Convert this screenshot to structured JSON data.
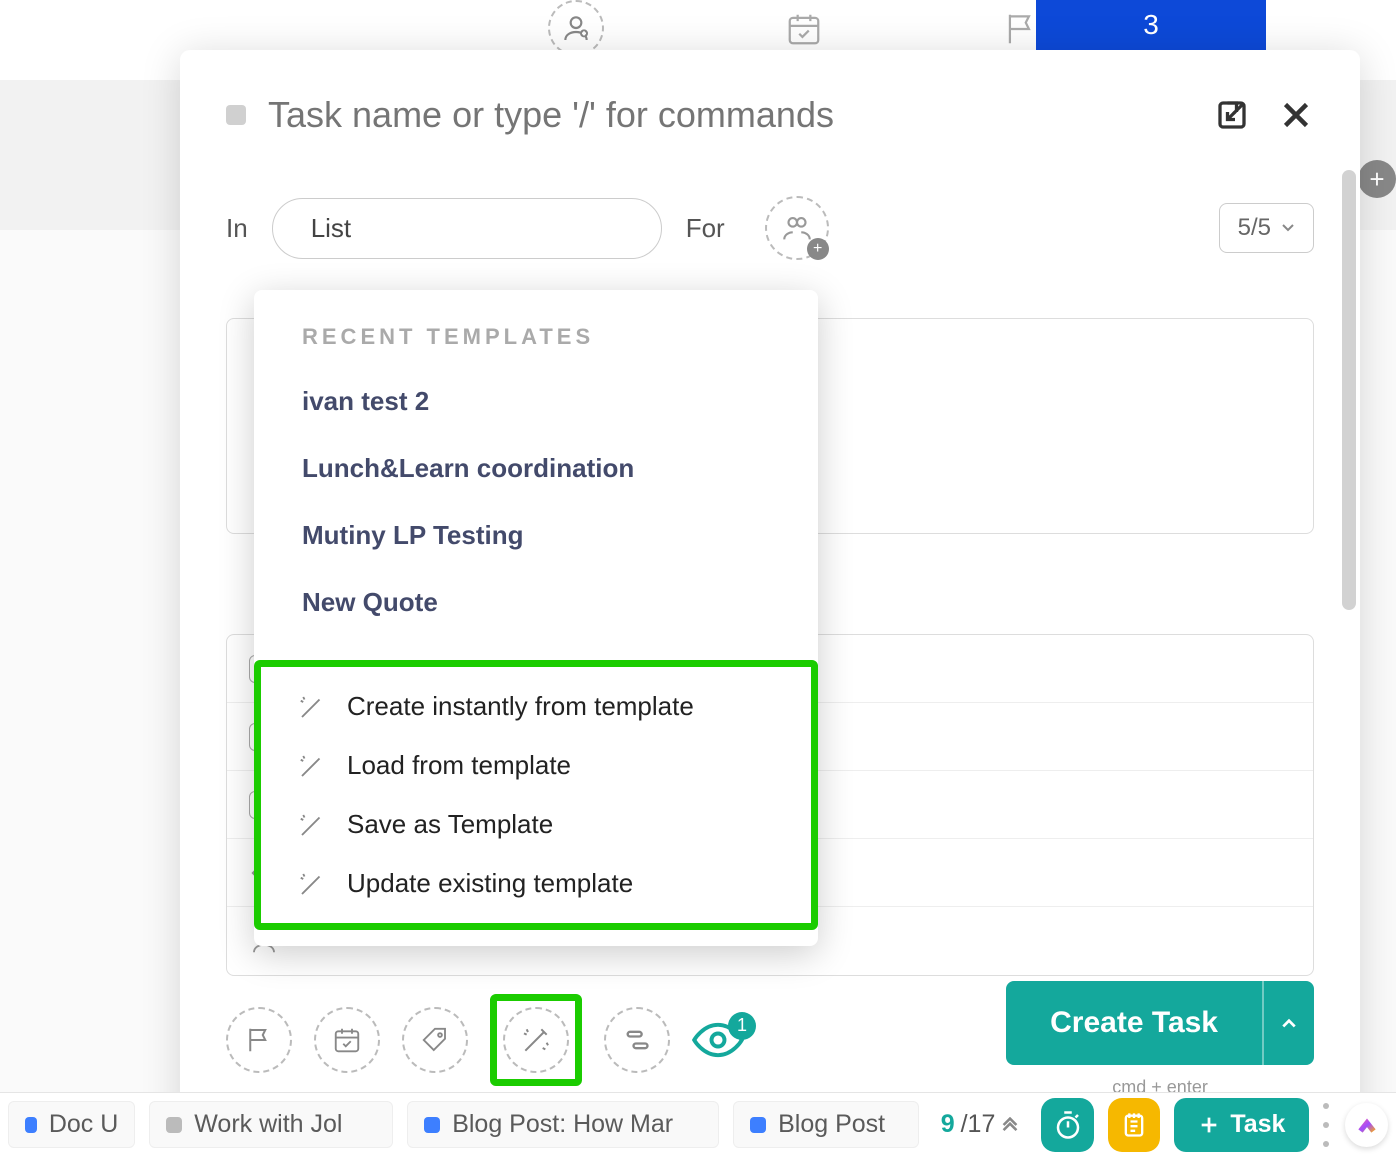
{
  "header": {
    "blue_pill": "3"
  },
  "modal": {
    "task_name_placeholder": "Task name or type '/' for commands",
    "in_label": "In",
    "list_value": "List",
    "for_label": "For",
    "count": "5/5",
    "create_label": "Create Task",
    "hint": "cmd + enter",
    "watchers_badge": "1"
  },
  "dropdown": {
    "section_title": "RECENT TEMPLATES",
    "templates": [
      "ivan test 2",
      "Lunch&Learn coordination",
      "Mutiny LP Testing",
      "New Quote"
    ],
    "actions": [
      "Create instantly from template",
      "Load from template",
      "Save as Template",
      "Update existing template"
    ]
  },
  "taskbar": {
    "chips": [
      {
        "label": "Doc U",
        "color": "blue"
      },
      {
        "label": "Work with Jol",
        "color": "gray"
      },
      {
        "label": "Blog Post: How Mar",
        "color": "blue"
      },
      {
        "label": "Blog Post",
        "color": "blue"
      }
    ],
    "count_current": "9",
    "count_total": "/17",
    "new_task_label": "Task"
  }
}
